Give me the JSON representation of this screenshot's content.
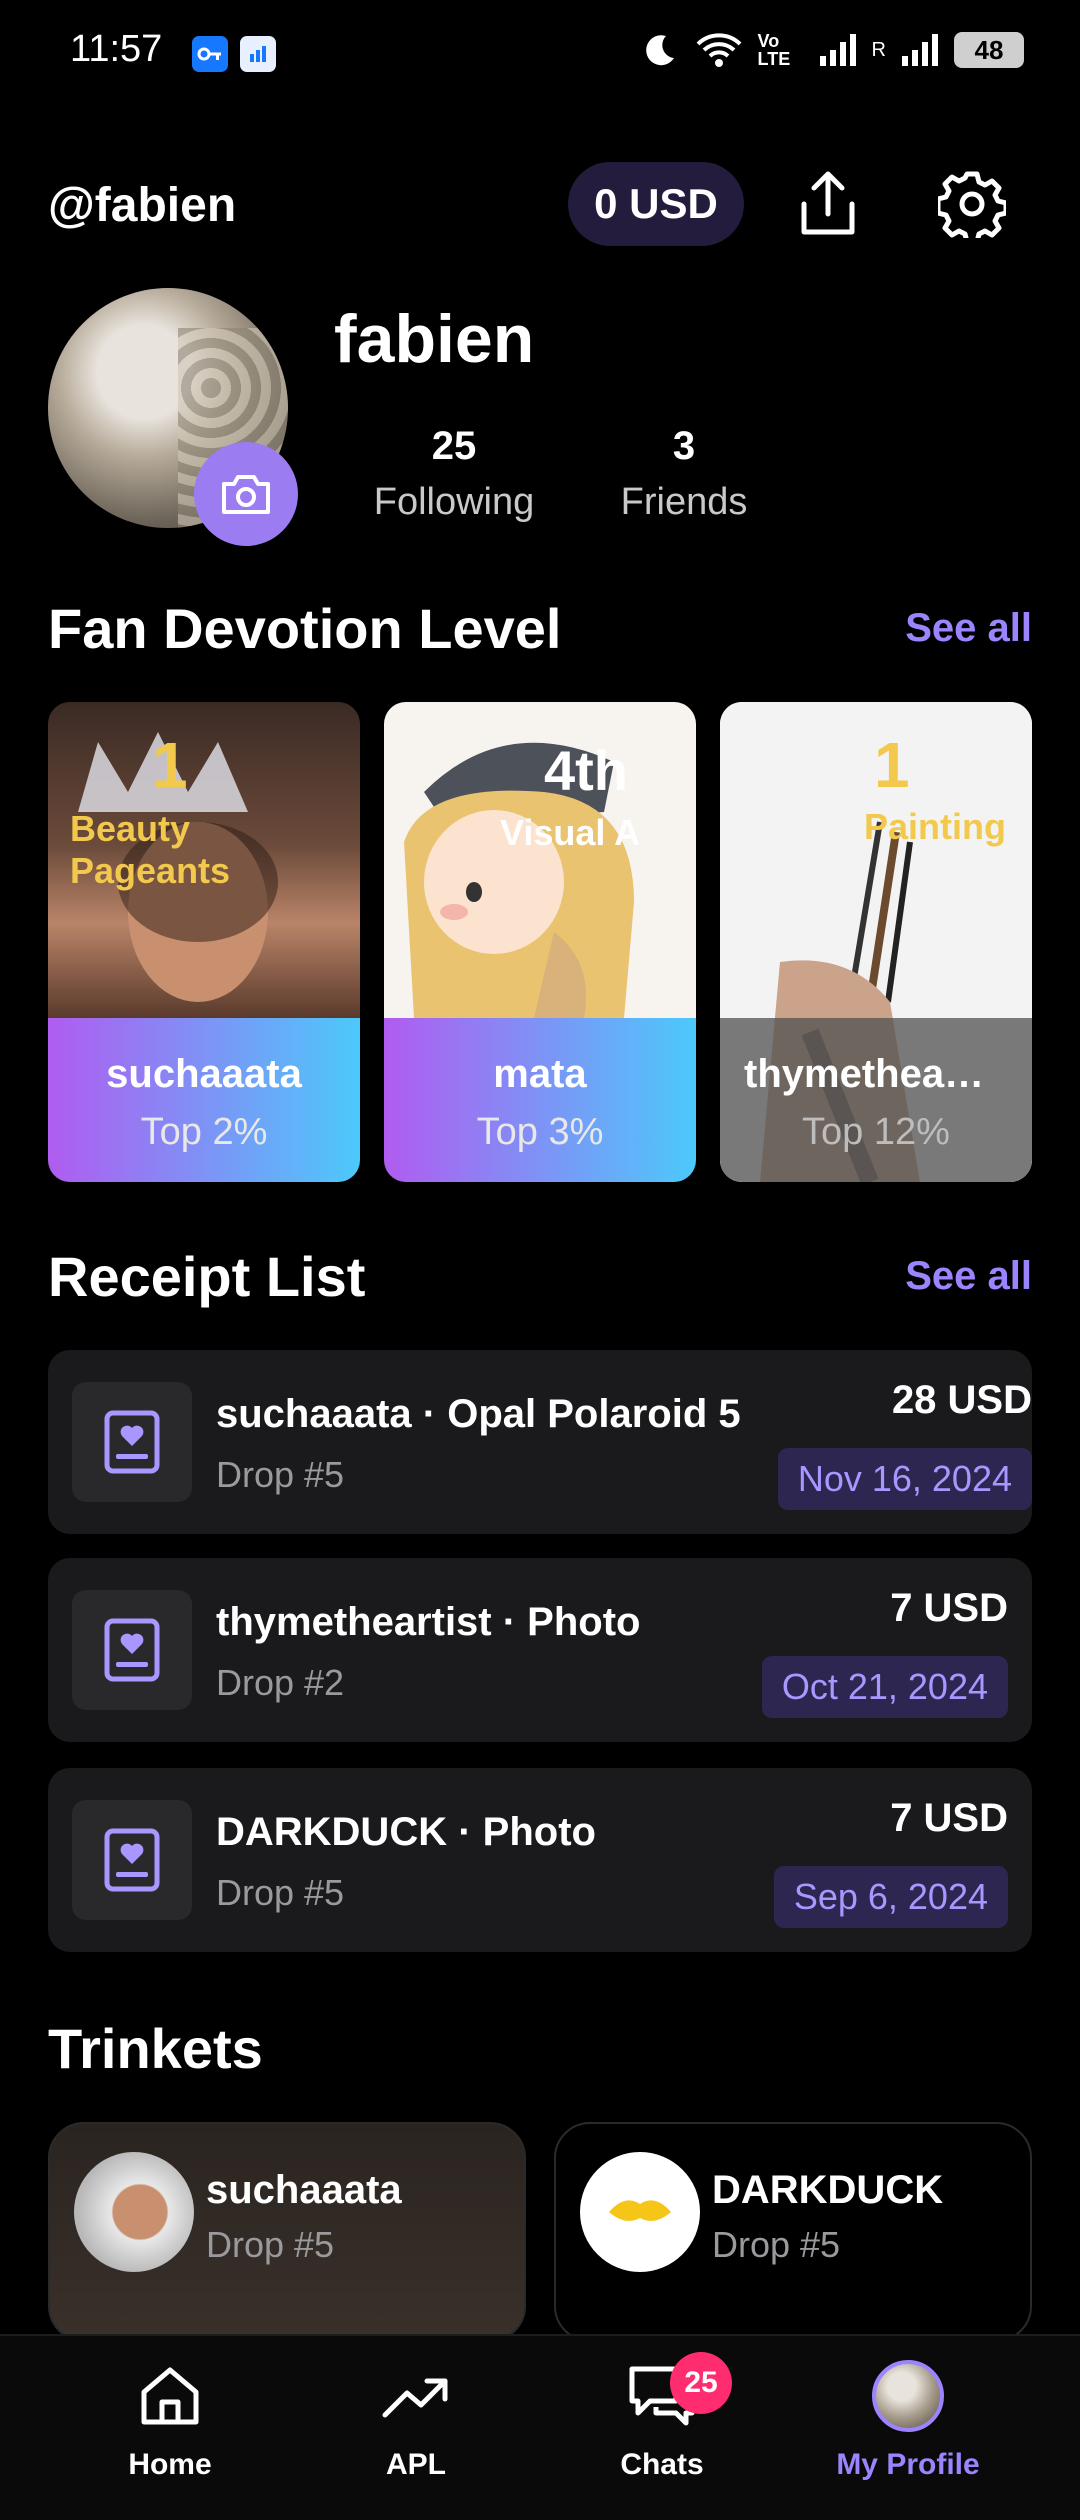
{
  "status_bar": {
    "time": "11:57",
    "battery": "48",
    "network": "Vo LTE",
    "roaming": "R"
  },
  "header": {
    "handle": "@fabien",
    "balance": "0 USD"
  },
  "profile": {
    "name": "fabien",
    "following_count": "25",
    "following_label": "Following",
    "friends_count": "3",
    "friends_label": "Friends"
  },
  "fan_devotion": {
    "title": "Fan Devotion Level",
    "see_all": "See all",
    "cards": [
      {
        "name": "suchaaata",
        "percent": "Top 2%",
        "rank": "1",
        "category": "Beauty Pageants"
      },
      {
        "name": "mata",
        "percent": "Top 3%",
        "rank": "4th",
        "category": "Visual A"
      },
      {
        "name": "thymethea…",
        "percent": "Top 12%",
        "rank": "1",
        "category": "Painting"
      }
    ]
  },
  "receipts": {
    "title": "Receipt List",
    "see_all": "See all",
    "items": [
      {
        "title": "suchaaata · Opal Polaroid 5",
        "drop": "Drop #5",
        "amount": "28 USD",
        "date": "Nov 16, 2024"
      },
      {
        "title": "thymetheartist · Photo",
        "drop": "Drop #2",
        "amount": "7 USD",
        "date": "Oct 21, 2024"
      },
      {
        "title": "DARKDUCK · Photo",
        "drop": "Drop #5",
        "amount": "7 USD",
        "date": "Sep 6, 2024"
      }
    ]
  },
  "trinkets": {
    "title": "Trinkets",
    "items": [
      {
        "name": "suchaaata",
        "drop": "Drop #5"
      },
      {
        "name": "DARKDUCK",
        "drop": "Drop #5"
      }
    ]
  },
  "nav": {
    "home": "Home",
    "apl": "APL",
    "chats": "Chats",
    "chats_badge": "25",
    "profile": "My Profile",
    "active_color": "#9c84ff"
  },
  "colors": {
    "accent": "#9c84ff",
    "card_gradient_start": "#b05cf0",
    "card_gradient_end": "#4cc9fb",
    "badge": "#ff2d6f"
  }
}
